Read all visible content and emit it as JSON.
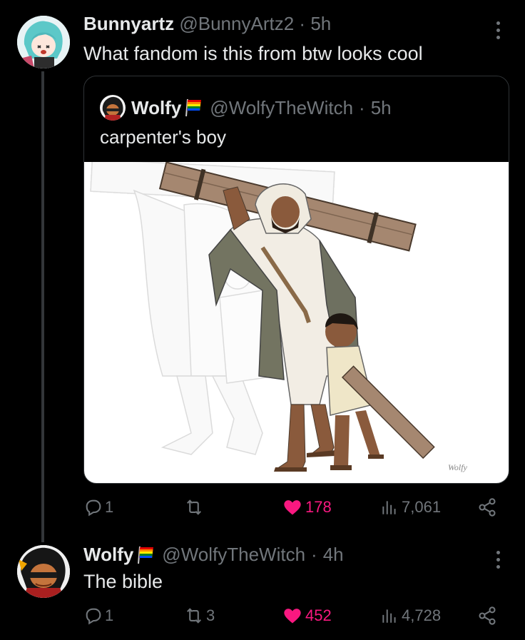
{
  "tweet1": {
    "name": "Bunnyartz",
    "handle": "@BunnyArtz2",
    "dot": "·",
    "time": "5h",
    "text": "What fandom is this from btw looks cool",
    "quote": {
      "name": "Wolfy",
      "handle": "@WolfyTheWitch",
      "dot": "·",
      "time": "5h",
      "text": "carpenter's boy",
      "image_signature": "Wolfy"
    },
    "stats": {
      "replies": "1",
      "reposts": "",
      "likes": "178",
      "views": "7,061"
    }
  },
  "tweet2": {
    "name": "Wolfy",
    "handle": "@WolfyTheWitch",
    "dot": "·",
    "time": "4h",
    "text": "The bible",
    "stats": {
      "replies": "1",
      "reposts": "3",
      "likes": "452",
      "views": "4,728"
    }
  },
  "colors": {
    "background": "#000000",
    "text": "#e7e9ea",
    "muted": "#71767b",
    "like": "#f91880",
    "border": "#2f3336"
  },
  "icons": [
    "reply-icon",
    "repost-icon",
    "heart-icon",
    "views-icon",
    "share-icon",
    "more-icon",
    "rainbow-flag-icon"
  ]
}
